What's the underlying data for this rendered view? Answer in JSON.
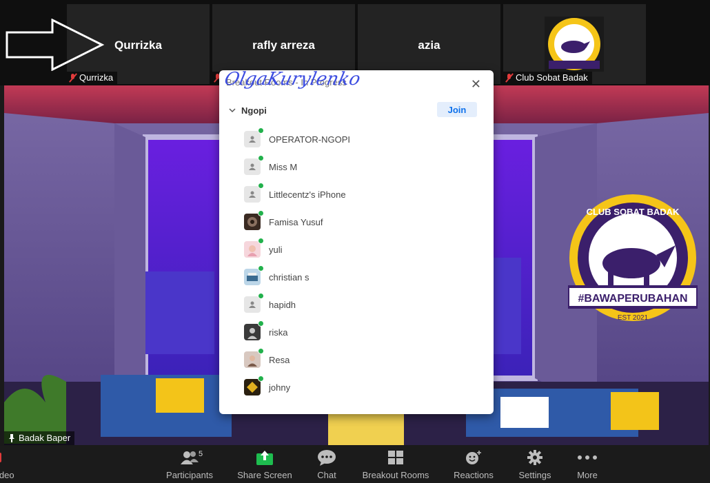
{
  "thumbnails": [
    {
      "display_name": "Qurrizka",
      "label": "Qurrizka"
    },
    {
      "display_name": "rafly arreza",
      "label": ""
    },
    {
      "display_name": "azia",
      "label": ""
    },
    {
      "display_name": "",
      "label": "Club Sobat Badak"
    }
  ],
  "main_video": {
    "pin_label": "Badak Baper",
    "logo_top_text": "CLUB SOBAT BADAK",
    "logo_banner_text": "#BAWAPERUBAHAN",
    "logo_est_text": "EST 2021"
  },
  "panel": {
    "title": "Breakout Rooms - In Progress",
    "signature_overlay": "OlgaKurylenko",
    "room_name": "Ngopi",
    "join_label": "Join",
    "participants": [
      {
        "name": "OPERATOR-NGOPI",
        "avatar": "default"
      },
      {
        "name": "Miss M",
        "avatar": "default"
      },
      {
        "name": "Littlecentz's iPhone",
        "avatar": "default"
      },
      {
        "name": "Famisa Yusuf",
        "avatar": "photo-dark"
      },
      {
        "name": "yuli",
        "avatar": "photo-pink"
      },
      {
        "name": "christian s",
        "avatar": "photo-blue"
      },
      {
        "name": "hapidh",
        "avatar": "default"
      },
      {
        "name": "riska",
        "avatar": "photo-gray"
      },
      {
        "name": "Resa",
        "avatar": "photo-light"
      },
      {
        "name": "johny",
        "avatar": "photo-yellow"
      }
    ]
  },
  "toolbar": {
    "video_label": "ideo",
    "participants_label": "Participants",
    "participants_count": "5",
    "share_label": "Share Screen",
    "chat_label": "Chat",
    "breakout_label": "Breakout Rooms",
    "reactions_label": "Reactions",
    "settings_label": "Settings",
    "more_label": "More"
  },
  "colors": {
    "online_dot": "#22b14c",
    "share_green": "#1ebd4f",
    "join_text": "#0e71eb",
    "logo_yellow": "#f5c518",
    "logo_purple": "#3b1f6b"
  }
}
